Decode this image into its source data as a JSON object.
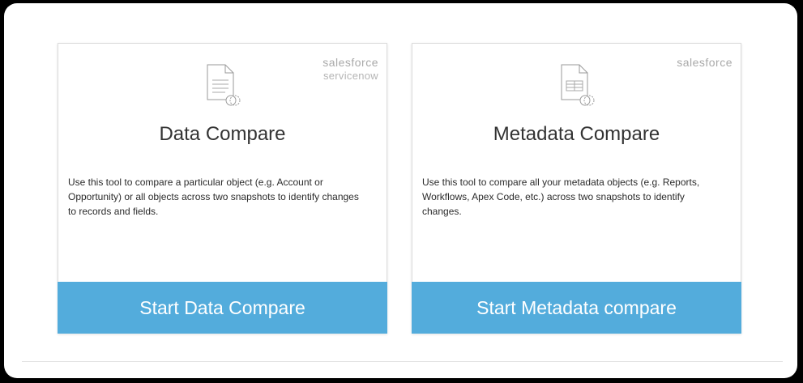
{
  "cards": [
    {
      "title": "Data Compare",
      "description": "Use this tool to compare a particular object (e.g. Account or Opportunity) or all objects across two snapshots to identify changes to records and fields.",
      "button_label": "Start Data Compare",
      "brand_primary": "salesforce",
      "brand_secondary": "servicenow",
      "icon": "document-compare-icon"
    },
    {
      "title": "Metadata Compare",
      "description": "Use this tool to compare all your metadata objects (e.g. Reports, Workflows, Apex Code, etc.) across two snapshots to identify changes.",
      "button_label": "Start Metadata compare",
      "brand_primary": "salesforce",
      "icon": "table-document-compare-icon"
    }
  ],
  "colors": {
    "button_bg": "#53acdc",
    "button_text": "#ffffff",
    "brand_text": "#a9a9a9"
  }
}
